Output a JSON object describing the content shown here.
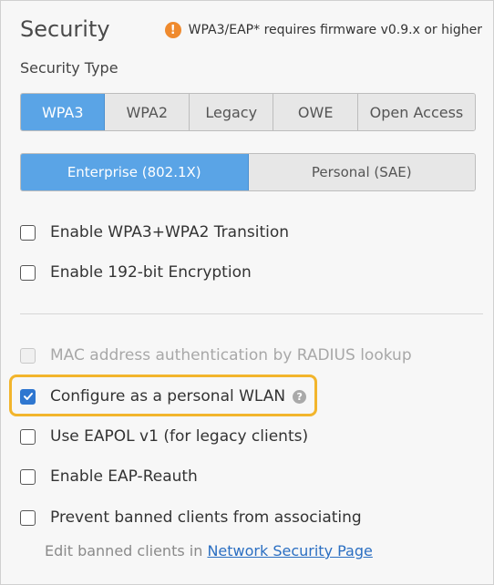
{
  "section": {
    "title": "Security",
    "warning_icon": "!",
    "warning_text": "WPA3/EAP* requires firmware v0.9.x or higher"
  },
  "security_type": {
    "label": "Security Type",
    "options": [
      "WPA3",
      "WPA2",
      "Legacy",
      "OWE",
      "Open Access"
    ],
    "selected": "WPA3"
  },
  "auth_mode": {
    "options": [
      "Enterprise (802.1X)",
      "Personal (SAE)"
    ],
    "selected": "Enterprise (802.1X)"
  },
  "checkboxes": {
    "transition": {
      "label": "Enable WPA3+WPA2 Transition",
      "checked": false
    },
    "encryption_192": {
      "label": "Enable 192-bit Encryption",
      "checked": false
    },
    "mac_auth": {
      "label": "MAC address authentication by RADIUS lookup",
      "checked": false,
      "disabled": true
    },
    "personal_wlan": {
      "label": "Configure as a personal WLAN",
      "checked": true,
      "help_icon": "?"
    },
    "eapol_v1": {
      "label": "Use EAPOL v1 (for legacy clients)",
      "checked": false
    },
    "eap_reauth": {
      "label": "Enable EAP-Reauth",
      "checked": false
    },
    "prevent_banned": {
      "label": "Prevent banned clients from associating",
      "checked": false
    }
  },
  "banned_note": {
    "prefix": "Edit banned clients in ",
    "link_text": "Network Security Page"
  },
  "colors": {
    "accent": "#5aa4e6",
    "checkbox_checked": "#2f77d0",
    "highlight": "#f2b52c",
    "warning": "#ef8a2e",
    "link": "#2b6fc2"
  }
}
